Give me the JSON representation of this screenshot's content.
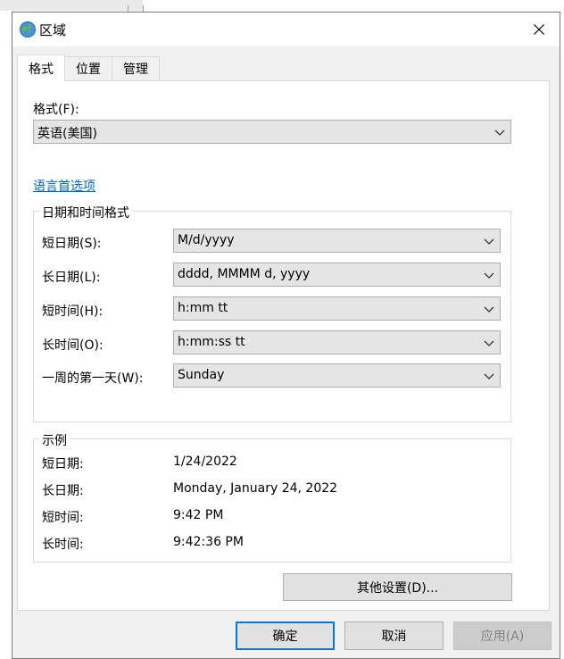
{
  "window": {
    "title": "区域",
    "close_icon": "close-icon"
  },
  "tabs": [
    {
      "label": "格式",
      "active": true
    },
    {
      "label": "位置",
      "active": false
    },
    {
      "label": "管理",
      "active": false
    }
  ],
  "format": {
    "label": "格式(F):",
    "value": "英语(美国)",
    "language_link": "语言首选项"
  },
  "datetime_group": {
    "title": "日期和时间格式",
    "rows": [
      {
        "label": "短日期(S):",
        "value": "M/d/yyyy"
      },
      {
        "label": "长日期(L):",
        "value": "dddd, MMMM d, yyyy"
      },
      {
        "label": "短时间(H):",
        "value": "h:mm tt"
      },
      {
        "label": "长时间(O):",
        "value": "h:mm:ss tt"
      },
      {
        "label": "一周的第一天(W):",
        "value": "Sunday"
      }
    ]
  },
  "example_group": {
    "title": "示例",
    "rows": [
      {
        "label": "短日期:",
        "value": "1/24/2022"
      },
      {
        "label": "长日期:",
        "value": "Monday, January 24, 2022"
      },
      {
        "label": "短时间:",
        "value": "9:42 PM"
      },
      {
        "label": "长时间:",
        "value": "9:42:36 PM"
      }
    ]
  },
  "buttons": {
    "other_settings": "其他设置(D)...",
    "ok": "确定",
    "cancel": "取消",
    "apply": "应用(A)"
  },
  "colors": {
    "accent": "#0078d7",
    "link": "#0066cc"
  }
}
